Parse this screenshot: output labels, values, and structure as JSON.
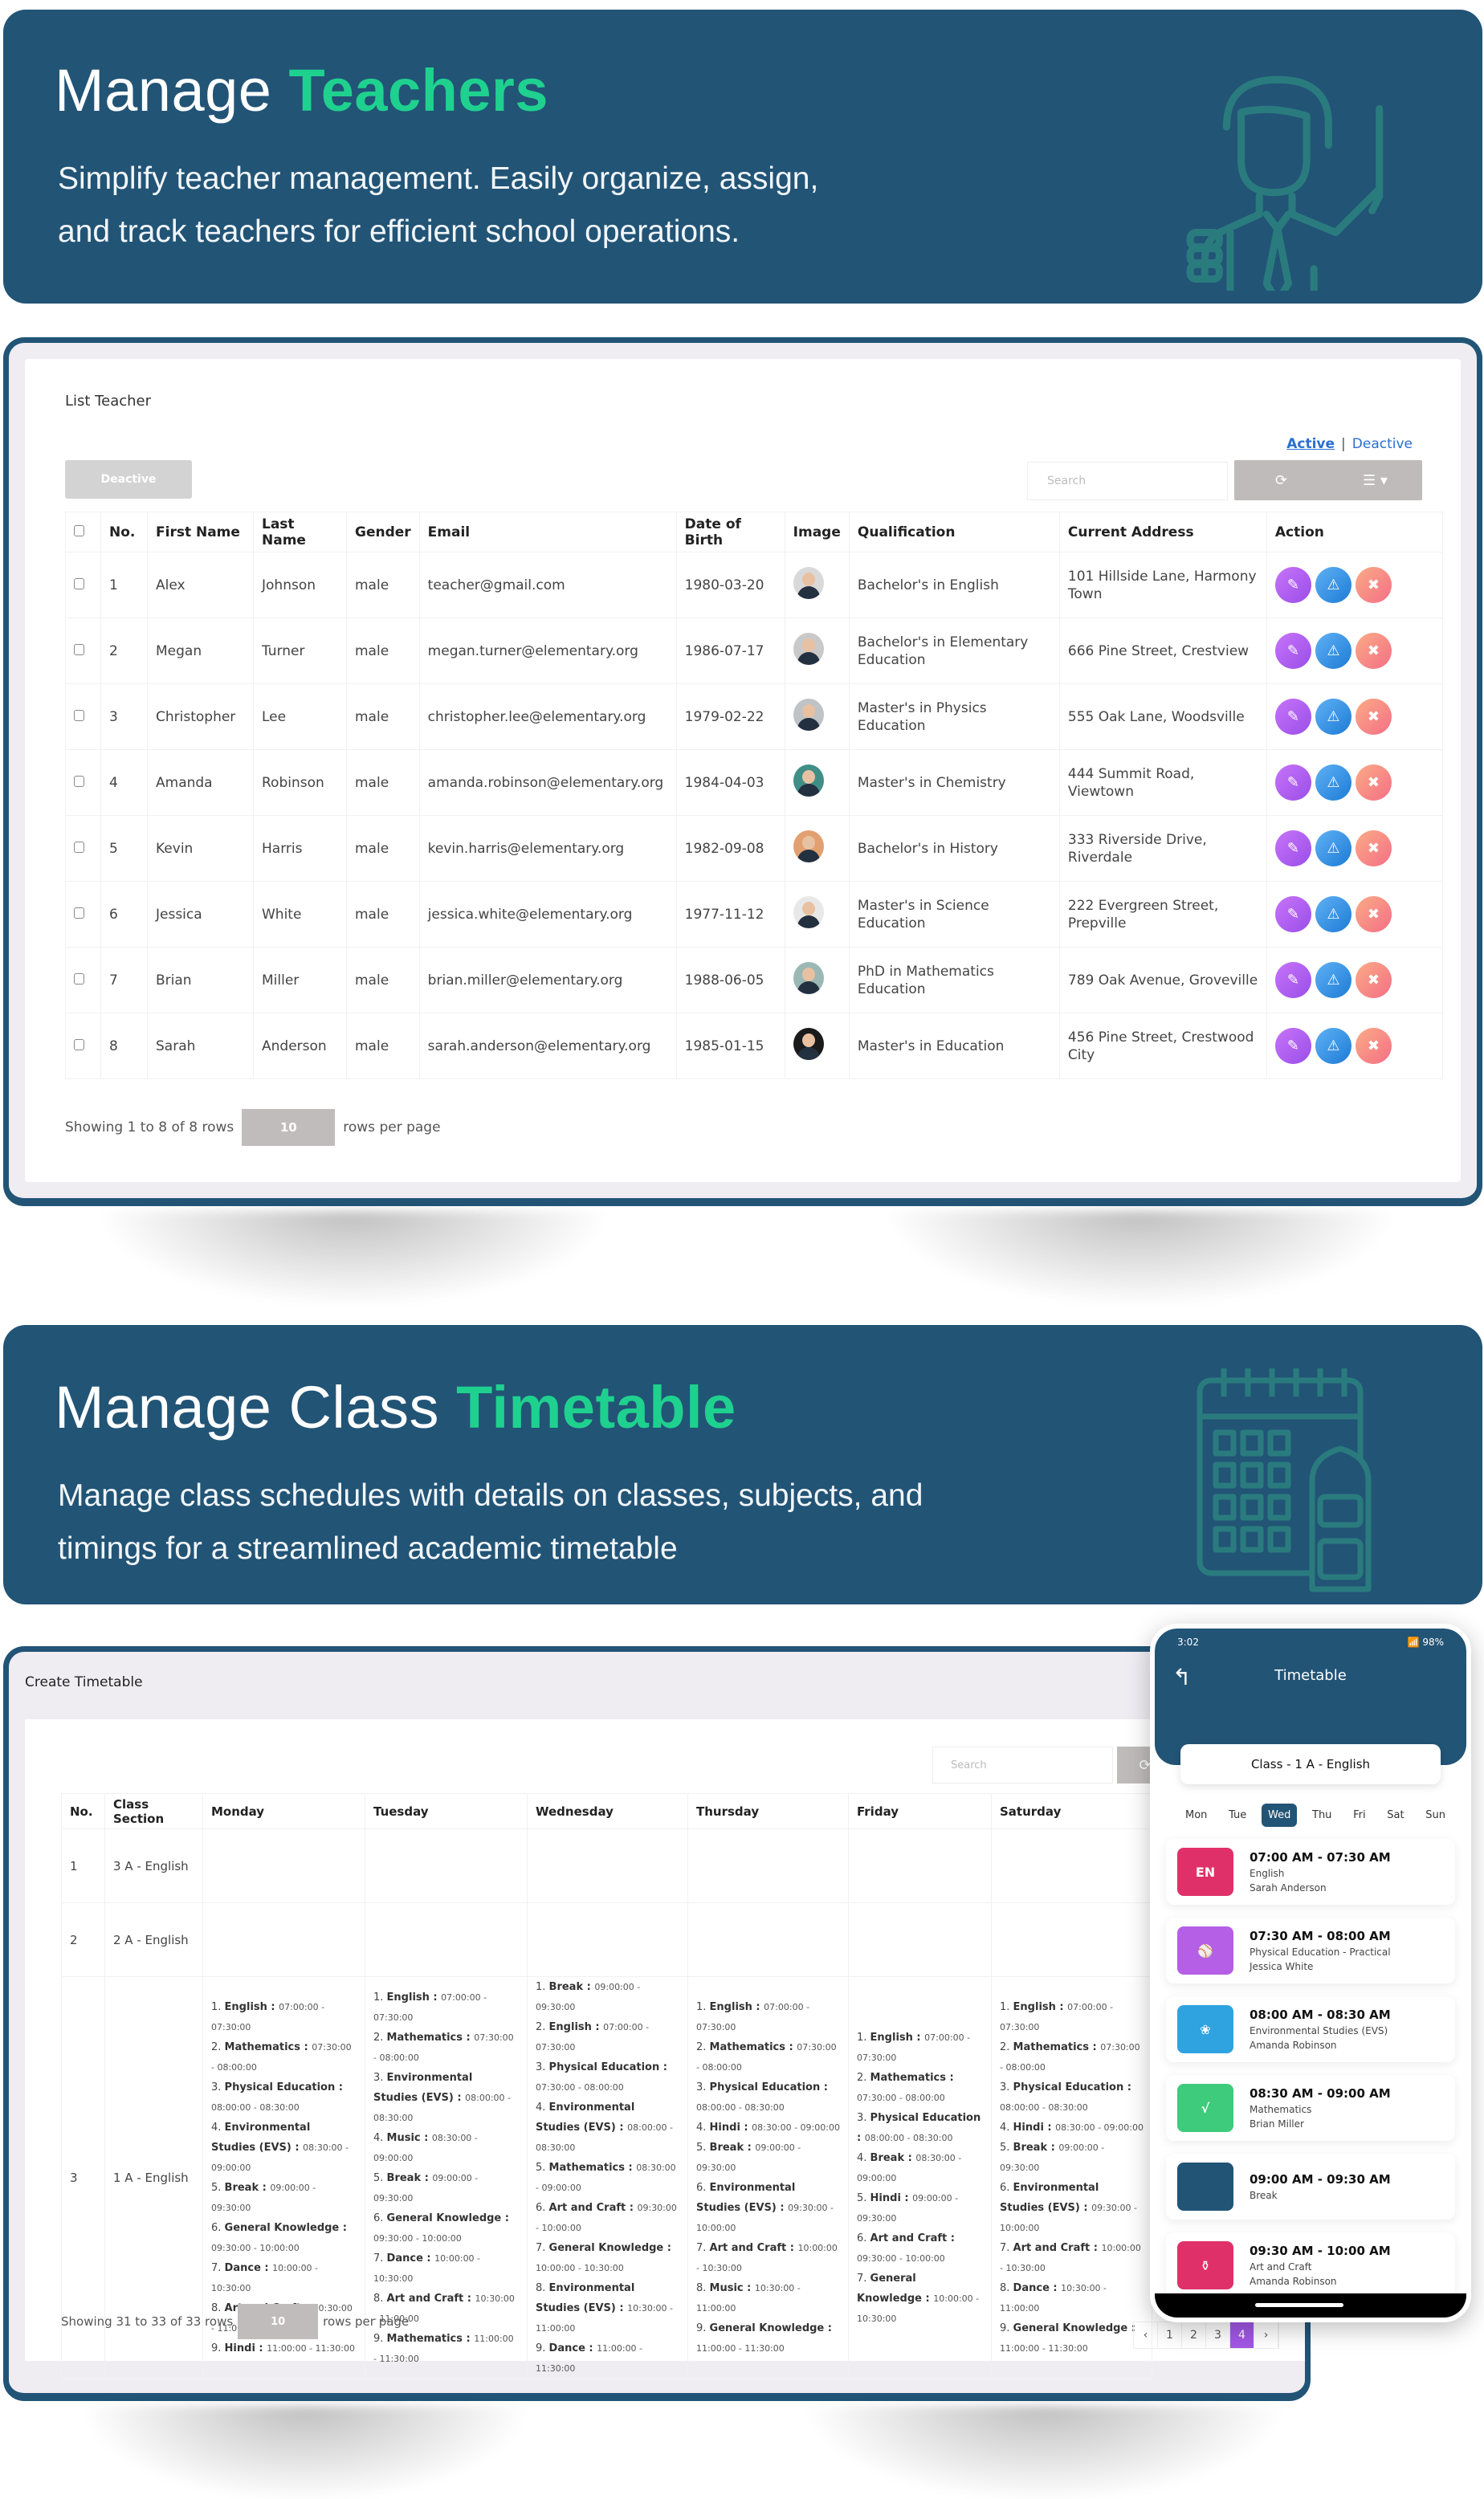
{
  "teachers_banner": {
    "title_plain": "Manage ",
    "title_accent": "Teachers",
    "subtitle_line1": "Simplify teacher management. Easily organize, assign,",
    "subtitle_line2": "and track teachers for efficient school operations.",
    "illustration_icon": "teacher-icon"
  },
  "teacher_list": {
    "title": "List Teacher",
    "status_active": "Active",
    "status_separator": "|",
    "status_deactive": "Deactive",
    "deactive_button": "Deactive",
    "search_placeholder": "Search",
    "refresh_icon": "refresh-icon",
    "columns_icon": "columns-icon",
    "columns": [
      "No.",
      "First Name",
      "Last Name",
      "Gender",
      "Email",
      "Date of Birth",
      "Image",
      "Qualification",
      "Current Address",
      "Action"
    ],
    "rows": [
      {
        "no": "1",
        "first": "Alex",
        "last": "Johnson",
        "gender": "male",
        "email": "teacher@gmail.com",
        "dob": "1980-03-20",
        "avatar_bg": "#d9d9d9",
        "qualification": "Bachelor's in English",
        "address": "101 Hillside Lane, Harmony Town"
      },
      {
        "no": "2",
        "first": "Megan",
        "last": "Turner",
        "gender": "male",
        "email": "megan.turner@elementary.org",
        "dob": "1986-07-17",
        "avatar_bg": "#c9c9c9",
        "qualification": "Bachelor's in Elementary Education",
        "address": "666 Pine Street, Crestview"
      },
      {
        "no": "3",
        "first": "Christopher",
        "last": "Lee",
        "gender": "male",
        "email": "christopher.lee@elementary.org",
        "dob": "1979-02-22",
        "avatar_bg": "#bfc3c6",
        "qualification": "Master's in Physics Education",
        "address": "555 Oak Lane, Woodsville"
      },
      {
        "no": "4",
        "first": "Amanda",
        "last": "Robinson",
        "gender": "male",
        "email": "amanda.robinson@elementary.org",
        "dob": "1984-04-03",
        "avatar_bg": "#3f8f87",
        "qualification": "Master's in Chemistry",
        "address": "444 Summit Road, Viewtown"
      },
      {
        "no": "5",
        "first": "Kevin",
        "last": "Harris",
        "gender": "male",
        "email": "kevin.harris@elementary.org",
        "dob": "1982-09-08",
        "avatar_bg": "#e2a070",
        "qualification": "Bachelor's in History",
        "address": "333 Riverside Drive, Riverdale"
      },
      {
        "no": "6",
        "first": "Jessica",
        "last": "White",
        "gender": "male",
        "email": "jessica.white@elementary.org",
        "dob": "1977-11-12",
        "avatar_bg": "#e8e8e8",
        "qualification": "Master's in Science Education",
        "address": "222 Evergreen Street, Prepville"
      },
      {
        "no": "7",
        "first": "Brian",
        "last": "Miller",
        "gender": "male",
        "email": "brian.miller@elementary.org",
        "dob": "1988-06-05",
        "avatar_bg": "#9bb8b5",
        "qualification": "PhD in Mathematics Education",
        "address": "789 Oak Avenue, Groveville"
      },
      {
        "no": "8",
        "first": "Sarah",
        "last": "Anderson",
        "gender": "male",
        "email": "sarah.anderson@elementary.org",
        "dob": "1985-01-15",
        "avatar_bg": "#1b1b1b",
        "qualification": "Master's in Education",
        "address": "456 Pine Street, Crestwood City"
      }
    ],
    "action_icons": [
      "edit-icon",
      "warning-icon",
      "close-icon"
    ],
    "footer_showing": "Showing 1 to 8 of 8 rows",
    "page_size": "10",
    "rows_per_page": "rows per page"
  },
  "timetable_banner": {
    "title_plain": "Manage Class ",
    "title_accent": "Timetable",
    "subtitle_line1": "Manage class schedules with details on classes, subjects, and",
    "subtitle_line2": "timings for a streamlined academic timetable",
    "illustration_icon": "calendar-backpack-icon"
  },
  "timetable": {
    "title": "Create Timetable",
    "search_placeholder": "Search",
    "columns": [
      "No.",
      "Class Section",
      "Monday",
      "Tuesday",
      "Wednesday",
      "Thursday",
      "Friday",
      "Saturday"
    ],
    "rows": [
      {
        "no": "1",
        "section": "3 A - English",
        "days": [
          [],
          [],
          [],
          [],
          [],
          []
        ]
      },
      {
        "no": "2",
        "section": "2 A - English",
        "days": [
          [],
          [],
          [],
          [],
          [],
          []
        ]
      },
      {
        "no": "3",
        "section": "1 A - English",
        "days": [
          [
            {
              "n": "1.",
              "s": "English",
              "t": "07:00:00 - 07:30:00"
            },
            {
              "n": "2.",
              "s": "Mathematics",
              "t": "07:30:00 - 08:00:00"
            },
            {
              "n": "3.",
              "s": "Physical Education",
              "t": "08:00:00 - 08:30:00"
            },
            {
              "n": "4.",
              "s": "Environmental Studies (EVS)",
              "t": "08:30:00 - 09:00:00"
            },
            {
              "n": "5.",
              "s": "Break",
              "t": "09:00:00 - 09:30:00"
            },
            {
              "n": "6.",
              "s": "General Knowledge",
              "t": "09:30:00 - 10:00:00"
            },
            {
              "n": "7.",
              "s": "Dance",
              "t": "10:00:00 - 10:30:00"
            },
            {
              "n": "8.",
              "s": "Art and Craft",
              "t": "10:30:00 - 11:00:00"
            },
            {
              "n": "9.",
              "s": "Hindi",
              "t": "11:00:00 - 11:30:00"
            }
          ],
          [
            {
              "n": "1.",
              "s": "English",
              "t": "07:00:00 - 07:30:00"
            },
            {
              "n": "2.",
              "s": "Mathematics",
              "t": "07:30:00 - 08:00:00"
            },
            {
              "n": "3.",
              "s": "Environmental Studies (EVS)",
              "t": "08:00:00 - 08:30:00"
            },
            {
              "n": "4.",
              "s": "Music",
              "t": "08:30:00 - 09:00:00"
            },
            {
              "n": "5.",
              "s": "Break",
              "t": "09:00:00 - 09:30:00"
            },
            {
              "n": "6.",
              "s": "General Knowledge",
              "t": "09:30:00 - 10:00:00"
            },
            {
              "n": "7.",
              "s": "Dance",
              "t": "10:00:00 - 10:30:00"
            },
            {
              "n": "8.",
              "s": "Art and Craft",
              "t": "10:30:00 - 11:00:00"
            },
            {
              "n": "9.",
              "s": "Mathematics",
              "t": "11:00:00 - 11:30:00"
            }
          ],
          [
            {
              "n": "1.",
              "s": "Break",
              "t": "09:00:00 - 09:30:00"
            },
            {
              "n": "2.",
              "s": "English",
              "t": "07:00:00 - 07:30:00"
            },
            {
              "n": "3.",
              "s": "Physical Education",
              "t": "07:30:00 - 08:00:00"
            },
            {
              "n": "4.",
              "s": "Environmental Studies (EVS)",
              "t": "08:00:00 - 08:30:00"
            },
            {
              "n": "5.",
              "s": "Mathematics",
              "t": "08:30:00 - 09:00:00"
            },
            {
              "n": "6.",
              "s": "Art and Craft",
              "t": "09:30:00 - 10:00:00"
            },
            {
              "n": "7.",
              "s": "General Knowledge",
              "t": "10:00:00 - 10:30:00"
            },
            {
              "n": "8.",
              "s": "Environmental Studies (EVS)",
              "t": "10:30:00 - 11:00:00"
            },
            {
              "n": "9.",
              "s": "Dance",
              "t": "11:00:00 - 11:30:00"
            }
          ],
          [
            {
              "n": "1.",
              "s": "English",
              "t": "07:00:00 - 07:30:00"
            },
            {
              "n": "2.",
              "s": "Mathematics",
              "t": "07:30:00 - 08:00:00"
            },
            {
              "n": "3.",
              "s": "Physical Education",
              "t": "08:00:00 - 08:30:00"
            },
            {
              "n": "4.",
              "s": "Hindi",
              "t": "08:30:00 - 09:00:00"
            },
            {
              "n": "5.",
              "s": "Break",
              "t": "09:00:00 - 09:30:00"
            },
            {
              "n": "6.",
              "s": "Environmental Studies (EVS)",
              "t": "09:30:00 - 10:00:00"
            },
            {
              "n": "7.",
              "s": "Art and Craft",
              "t": "10:00:00 - 10:30:00"
            },
            {
              "n": "8.",
              "s": "Music",
              "t": "10:30:00 - 11:00:00"
            },
            {
              "n": "9.",
              "s": "General Knowledge",
              "t": "11:00:00 - 11:30:00"
            }
          ],
          [
            {
              "n": "1.",
              "s": "English",
              "t": "07:00:00 - 07:30:00"
            },
            {
              "n": "2.",
              "s": "Mathematics",
              "t": "07:30:00 - 08:00:00"
            },
            {
              "n": "3.",
              "s": "Physical Education",
              "t": "08:00:00 - 08:30:00"
            },
            {
              "n": "4.",
              "s": "Break",
              "t": "08:30:00 - 09:00:00"
            },
            {
              "n": "5.",
              "s": "Hindi",
              "t": "09:00:00 - 09:30:00"
            },
            {
              "n": "6.",
              "s": "Art and Craft",
              "t": "09:30:00 - 10:00:00"
            },
            {
              "n": "7.",
              "s": "General Knowledge",
              "t": "10:00:00 - 10:30:00"
            }
          ],
          [
            {
              "n": "1.",
              "s": "English",
              "t": "07:00:00 - 07:30:00"
            },
            {
              "n": "2.",
              "s": "Mathematics",
              "t": "07:30:00 - 08:00:00"
            },
            {
              "n": "3.",
              "s": "Physical Education",
              "t": "08:00:00 - 08:30:00"
            },
            {
              "n": "4.",
              "s": "Hindi",
              "t": "08:30:00 - 09:00:00"
            },
            {
              "n": "5.",
              "s": "Break",
              "t": "09:00:00 - 09:30:00"
            },
            {
              "n": "6.",
              "s": "Environmental Studies (EVS)",
              "t": "09:30:00 - 10:00:00"
            },
            {
              "n": "7.",
              "s": "Art and Craft",
              "t": "10:00:00 - 10:30:00"
            },
            {
              "n": "8.",
              "s": "Dance",
              "t": "10:30:00 - 11:00:00"
            },
            {
              "n": "9.",
              "s": "General Knowledge",
              "t": "11:00:00 - 11:30:00"
            }
          ]
        ]
      }
    ],
    "footer_showing": "Showing 31 to 33 of 33 rows",
    "page_size": "10",
    "rows_per_page": "rows per page",
    "pagination": [
      "‹",
      "1",
      "2",
      "3",
      "4",
      "›"
    ],
    "current_page": "4"
  },
  "phone": {
    "time": "3:02",
    "status_icons": "VoLTE 0KB/s wifi signal",
    "battery": "98%",
    "title": "Timetable",
    "class_label": "Class - 1 A - English",
    "days": [
      "Mon",
      "Tue",
      "Wed",
      "Thu",
      "Fri",
      "Sat",
      "Sun"
    ],
    "selected_day": "Wed",
    "slots": [
      {
        "time": "07:00 AM - 07:30 AM",
        "subject": "English",
        "teacher": "Sarah Anderson",
        "icon": "english-book-icon",
        "icon_text": "EN",
        "color": "#e0306a"
      },
      {
        "time": "07:30 AM - 08:00 AM",
        "subject": "Physical Education - Practical",
        "teacher": "Jessica White",
        "icon": "sports-book-icon",
        "icon_text": "⚾",
        "color": "#b45fe6"
      },
      {
        "time": "08:00 AM - 08:30 AM",
        "subject": "Environmental Studies (EVS)",
        "teacher": "Amanda Robinson",
        "icon": "plant-book-icon",
        "icon_text": "❀",
        "color": "#2fa3e0"
      },
      {
        "time": "08:30 AM - 09:00 AM",
        "subject": "Mathematics",
        "teacher": "Brian Miller",
        "icon": "math-book-icon",
        "icon_text": "√",
        "color": "#3ecb7c"
      },
      {
        "time": "09:00 AM - 09:30 AM",
        "subject": "Break",
        "teacher": "",
        "icon": "break-icon",
        "icon_text": "",
        "color": "#225476"
      },
      {
        "time": "09:30 AM - 10:00 AM",
        "subject": "Art and Craft",
        "teacher": "Amanda Robinson",
        "icon": "vase-brush-icon",
        "icon_text": "⚱",
        "color": "#e0306a"
      }
    ]
  }
}
